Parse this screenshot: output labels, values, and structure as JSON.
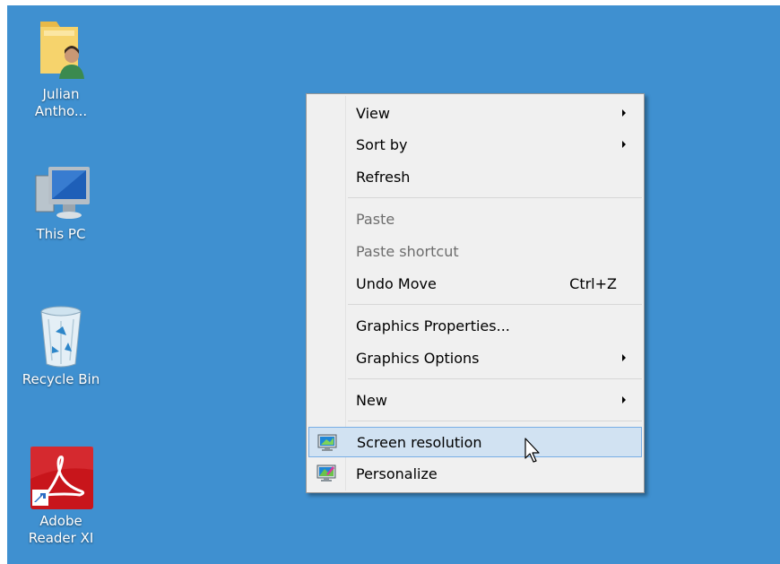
{
  "desktop": {
    "background_color": "#3f90d0",
    "icons": [
      {
        "label_line1": "Julian",
        "label_line2": "Antho...",
        "icon": "user-folder-icon"
      },
      {
        "label_line1": "This PC",
        "label_line2": "",
        "icon": "computer-icon"
      },
      {
        "label_line1": "Recycle Bin",
        "label_line2": "",
        "icon": "recycle-bin-icon"
      },
      {
        "label_line1": "Adobe",
        "label_line2": "Reader XI",
        "icon": "adobe-reader-icon"
      }
    ]
  },
  "context_menu": {
    "items": [
      {
        "label": "View",
        "submenu": true
      },
      {
        "label": "Sort by",
        "submenu": true
      },
      {
        "label": "Refresh"
      },
      {
        "label": "Paste",
        "disabled": true
      },
      {
        "label": "Paste shortcut",
        "disabled": true
      },
      {
        "label": "Undo Move",
        "shortcut": "Ctrl+Z"
      },
      {
        "label": "Graphics Properties..."
      },
      {
        "label": "Graphics Options",
        "submenu": true
      },
      {
        "label": "New",
        "submenu": true
      },
      {
        "label": "Screen resolution",
        "icon": "screen-resolution-icon",
        "highlighted": true
      },
      {
        "label": "Personalize",
        "icon": "personalize-icon"
      }
    ],
    "hover_color": "#d1e2f2",
    "hover_border_color": "#78aee5"
  }
}
